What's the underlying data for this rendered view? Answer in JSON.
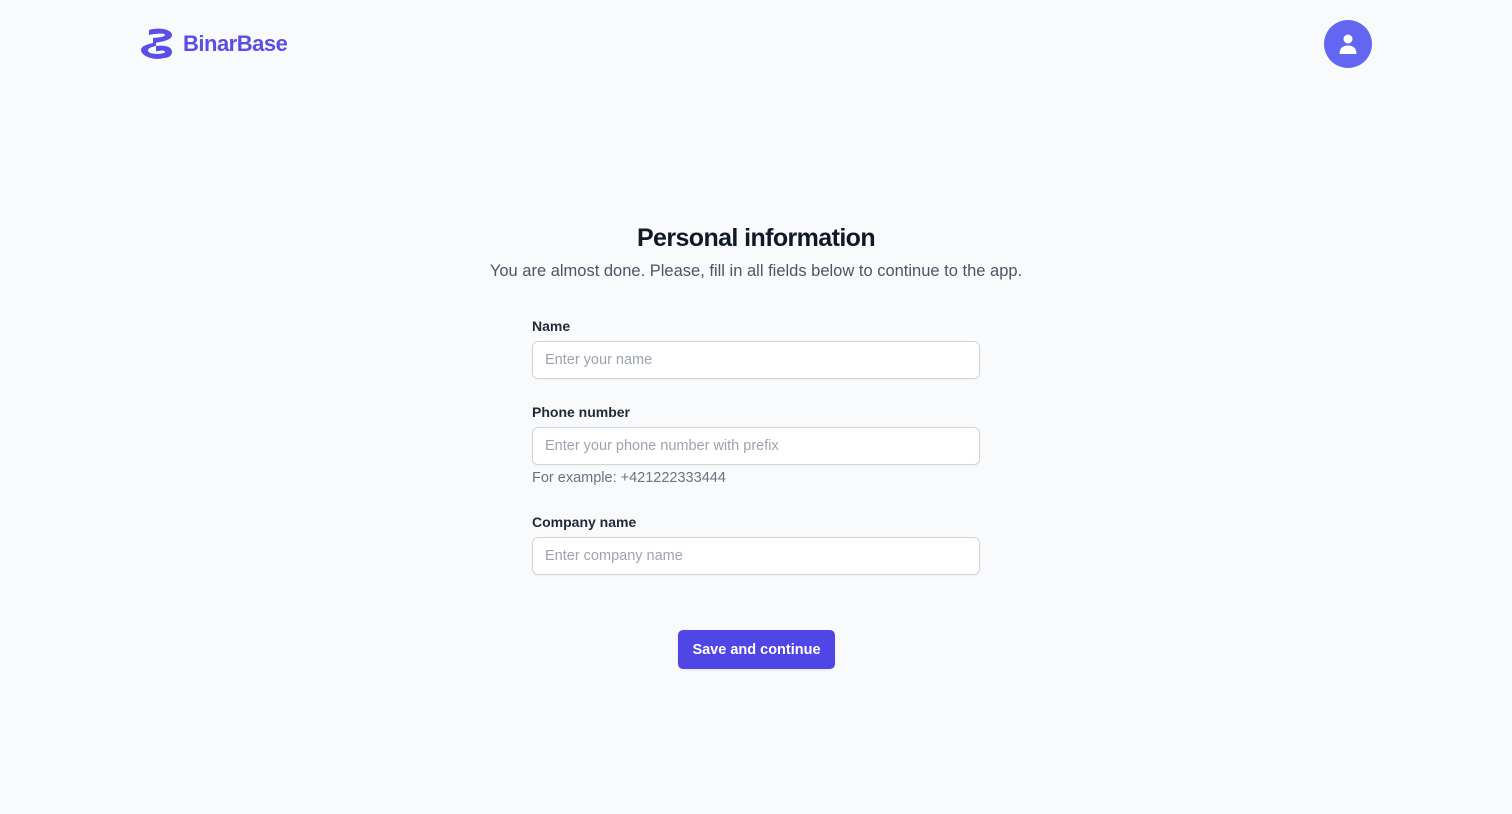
{
  "header": {
    "brand_name": "BinarBase",
    "logo_icon": "binarbase-logo-icon",
    "account_icon": "user-icon"
  },
  "main": {
    "title": "Personal information",
    "subtitle": "You are almost done. Please, fill in all fields below to continue to the app.",
    "fields": {
      "name": {
        "label": "Name",
        "value": "",
        "placeholder": "Enter your name"
      },
      "phone": {
        "label": "Phone number",
        "value": "",
        "placeholder": "Enter your phone number with prefix",
        "hint": "For example: +421222333444"
      },
      "company": {
        "label": "Company name",
        "value": "",
        "placeholder": "Enter company name"
      }
    },
    "submit_label": "Save and continue"
  },
  "colors": {
    "background": "#f9fafb",
    "brand": "#5b4ee6",
    "avatar": "#6366f1",
    "primary_button": "#4f46e5",
    "title": "#111827",
    "subtitle": "#4b5563"
  }
}
